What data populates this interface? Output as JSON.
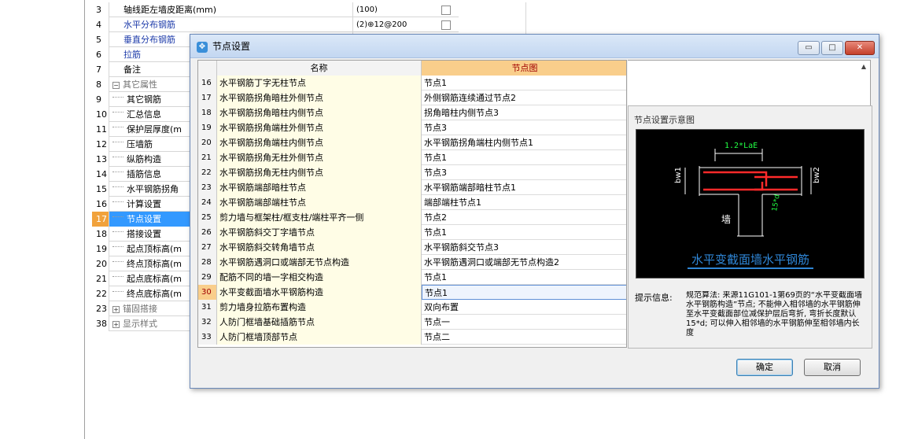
{
  "background_grid": {
    "rows": [
      {
        "num": "3",
        "name": "轴线距左墙皮距离(mm)",
        "value": "(100)",
        "style": "normal",
        "check": true
      },
      {
        "num": "4",
        "name": "水平分布钢筋",
        "value": "(2)⊕12@200",
        "style": "blue",
        "check": true
      },
      {
        "num": "5",
        "name": "垂直分布钢筋",
        "value": "",
        "style": "blue",
        "check": false
      },
      {
        "num": "6",
        "name": "拉筋",
        "value": "",
        "style": "blue",
        "check": false
      },
      {
        "num": "7",
        "name": "备注",
        "value": "",
        "style": "normal",
        "check": false
      },
      {
        "num": "8",
        "name": "其它属性",
        "value": "",
        "style": "group",
        "pm": "−",
        "check": false
      },
      {
        "num": "9",
        "name": "其它钢筋",
        "value": "",
        "style": "child",
        "check": false
      },
      {
        "num": "10",
        "name": "汇总信息",
        "value": "",
        "style": "child",
        "check": false
      },
      {
        "num": "11",
        "name": "保护层厚度(m",
        "value": "",
        "style": "child",
        "check": false
      },
      {
        "num": "12",
        "name": "压墙筋",
        "value": "",
        "style": "child",
        "check": false
      },
      {
        "num": "13",
        "name": "纵筋构造",
        "value": "",
        "style": "child",
        "check": false
      },
      {
        "num": "14",
        "name": "插筋信息",
        "value": "",
        "style": "child",
        "check": false
      },
      {
        "num": "15",
        "name": "水平钢筋拐角",
        "value": "",
        "style": "child",
        "check": false
      },
      {
        "num": "16",
        "name": "计算设置",
        "value": "",
        "style": "child",
        "check": false
      },
      {
        "num": "17",
        "name": "节点设置",
        "value": "",
        "style": "child-sel",
        "check": false
      },
      {
        "num": "18",
        "name": "搭接设置",
        "value": "",
        "style": "child",
        "check": false
      },
      {
        "num": "19",
        "name": "起点顶标高(m",
        "value": "",
        "style": "child",
        "check": false
      },
      {
        "num": "20",
        "name": "终点顶标高(m",
        "value": "",
        "style": "child",
        "check": false
      },
      {
        "num": "21",
        "name": "起点底标高(m",
        "value": "",
        "style": "child",
        "check": false
      },
      {
        "num": "22",
        "name": "终点底标高(m",
        "value": "",
        "style": "child",
        "check": false
      },
      {
        "num": "23",
        "name": "锚固搭接",
        "value": "",
        "style": "group",
        "pm": "+",
        "check": false
      },
      {
        "num": "38",
        "name": "显示样式",
        "value": "",
        "style": "group",
        "pm": "+",
        "check": false
      }
    ]
  },
  "dialog": {
    "title": "节点设置",
    "window_buttons": {
      "minimize": "▭",
      "maximize": "□",
      "close": "✕"
    },
    "grid": {
      "headers": {
        "name": "名称",
        "node": "节点图"
      },
      "rows": [
        {
          "num": "16",
          "name": "水平钢筋丁字无柱节点",
          "value": "节点1"
        },
        {
          "num": "17",
          "name": "水平钢筋拐角暗柱外侧节点",
          "value": "外侧钢筋连续通过节点2"
        },
        {
          "num": "18",
          "name": "水平钢筋拐角暗柱内侧节点",
          "value": "拐角暗柱内侧节点3"
        },
        {
          "num": "19",
          "name": "水平钢筋拐角端柱外侧节点",
          "value": "节点3"
        },
        {
          "num": "20",
          "name": "水平钢筋拐角端柱内侧节点",
          "value": "水平钢筋拐角端柱内侧节点1"
        },
        {
          "num": "21",
          "name": "水平钢筋拐角无柱外侧节点",
          "value": "节点1"
        },
        {
          "num": "22",
          "name": "水平钢筋拐角无柱内侧节点",
          "value": "节点3"
        },
        {
          "num": "23",
          "name": "水平钢筋端部暗柱节点",
          "value": "水平钢筋端部暗柱节点1"
        },
        {
          "num": "24",
          "name": "水平钢筋端部端柱节点",
          "value": "端部端柱节点1"
        },
        {
          "num": "25",
          "name": "剪力墙与框架柱/框支柱/端柱平齐一侧",
          "value": "节点2"
        },
        {
          "num": "26",
          "name": "水平钢筋斜交丁字墙节点",
          "value": "节点1"
        },
        {
          "num": "27",
          "name": "水平钢筋斜交转角墙节点",
          "value": "水平钢筋斜交节点3"
        },
        {
          "num": "28",
          "name": "水平钢筋遇洞口或端部无节点构造",
          "value": "水平钢筋遇洞口或端部无节点构造2"
        },
        {
          "num": "29",
          "name": "配筋不同的墙一字相交构造",
          "value": "节点1"
        },
        {
          "num": "30",
          "name": "水平变截面墙水平钢筋构造",
          "value": "节点1",
          "selected": true
        },
        {
          "num": "31",
          "name": "剪力墙身拉筋布置构造",
          "value": "双向布置"
        },
        {
          "num": "32",
          "name": "人防门框墙基础插筋节点",
          "value": "节点一"
        },
        {
          "num": "33",
          "name": "人防门框墙顶部节点",
          "value": "节点二"
        }
      ]
    },
    "diagram": {
      "title": "节点设置示意图",
      "caption": "水平变截面墙水平钢筋",
      "labels": {
        "top": "1.2*LaE",
        "bw1": "bw1",
        "bw2": "bw2",
        "wall": "墙",
        "side": "15*d"
      }
    },
    "hint": {
      "label": "提示信息:",
      "text": "规范算法: 来源11G101-1第69页的“水平变截面墙水平钢筋构造”节点; 不能伸入相邻墙的水平钢筋伸至水平变截面部位减保护层后弯折, 弯折长度默认15*d; 可以伸入相邻墙的水平钢筋伸至相邻墙内长度"
    },
    "buttons": {
      "ok": "确定",
      "cancel": "取消"
    }
  },
  "colors": {
    "selected_row_bg": "#3399ff",
    "selected_num_bg": "#f1a23c",
    "header_node_bg": "#f9ce8b",
    "name_cell_bg": "#fffde6",
    "diagram_caption": "#2f86d6",
    "rebar": "#ff2a2a"
  }
}
